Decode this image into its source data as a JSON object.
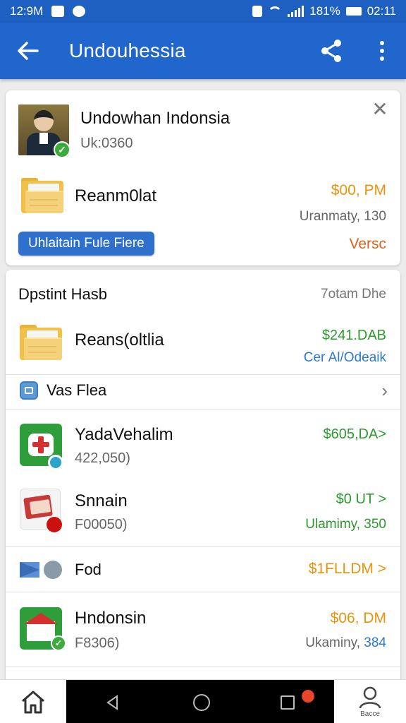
{
  "status_bar": {
    "time_left": "12:9M",
    "battery_pct": "181%",
    "time_right": "02:11"
  },
  "app_bar": {
    "title": "Undouhessia"
  },
  "header_card": {
    "name": "Undowhan Indonsia",
    "sub": "Uk:0360",
    "file_title": "Reanm0lat",
    "file_amount": "$00, PM",
    "file_meta": "Uranmaty, 130",
    "action_button": "Uhlaitain Fule Fiere",
    "action_right": "Versc"
  },
  "list_card": {
    "header_left": "Dpstint Hasb",
    "header_right": "7otam Dhe",
    "rows": [
      {
        "title": "Reans(oltlia",
        "amount": "$241.DAB",
        "sub_right": "Cer Al/Odeaik"
      },
      {
        "title": "Vas Flea"
      },
      {
        "title": "YadaVehalim",
        "sub": "422,050)",
        "amount": "$605,DA>"
      },
      {
        "title": "Snnain",
        "sub": "F00050)",
        "amount": "$0 UT >",
        "sub_right": "Ulamimy, 350"
      },
      {
        "title": "Fod",
        "amount": "$1FLLDM >"
      },
      {
        "title": "Hndonsin",
        "sub": "F8306)",
        "amount": "$06, DM",
        "sub_right_a": "Ukaminy, ",
        "sub_right_b": "384"
      }
    ]
  },
  "bottom_nav": {
    "profile_label": "Bacce"
  },
  "colors": {
    "primary": "#2166cc",
    "status": "#1e5fc2",
    "green": "#2c9a2c",
    "orange": "#e8930d",
    "link_blue": "#2a7ad0"
  },
  "icons": [
    "back-arrow-icon",
    "share-icon",
    "more-vert-icon",
    "close-icon",
    "folder-icon",
    "chevron-right-icon",
    "home-icon",
    "profile-icon"
  ]
}
